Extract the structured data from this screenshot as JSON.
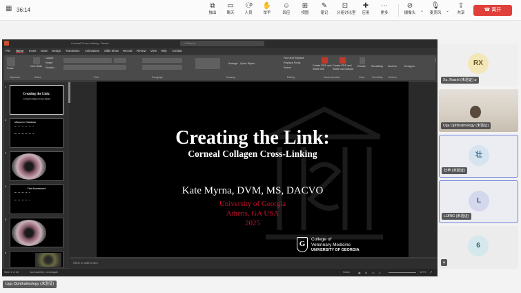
{
  "meeting": {
    "timer": "36:14",
    "toolbar": [
      {
        "label": "独出",
        "icon": "pop-out-icon"
      },
      {
        "label": "聊天",
        "icon": "chat-icon"
      },
      {
        "label": "人员",
        "icon": "people-icon",
        "count": "5"
      },
      {
        "label": "举手",
        "icon": "raise-hand-icon"
      },
      {
        "label": "回应",
        "icon": "react-icon"
      },
      {
        "label": "视图",
        "icon": "view-icon"
      },
      {
        "label": "笔记",
        "icon": "notes-icon"
      },
      {
        "label": "分组讨论室",
        "icon": "breakout-icon"
      },
      {
        "label": "应用",
        "icon": "apps-icon"
      },
      {
        "label": "更多",
        "icon": "more-icon"
      }
    ],
    "camera_label": "摄像头",
    "mic_label": "麦克风",
    "share_label": "共享",
    "leave_label": "离开"
  },
  "powerpoint": {
    "title": "Corneal Cross-Linking - Saved",
    "search_placeholder": "Search",
    "tabs": [
      "File",
      "Home",
      "Insert",
      "Draw",
      "Design",
      "Transitions",
      "Animations",
      "Slide Show",
      "Record",
      "Review",
      "View",
      "Help",
      "Acrobat"
    ],
    "active_tab": "Home",
    "share_label": "Share",
    "ribbon_groups": [
      "Clipboard",
      "Slides",
      "Font",
      "Paragraph",
      "Drawing",
      "Editing",
      "Adobe Acrobat",
      "Voice",
      "Sensitivity",
      "Add-ins"
    ],
    "ribbon_buttons": {
      "paste": "Paste",
      "new_slide": "New Slide",
      "layout": "Layout",
      "reset": "Reset",
      "section": "Section",
      "arrange": "Arrange",
      "quick_styles": "Quick Styles",
      "find_replace": "Find and Replace",
      "replace_fonts": "Replace Fonts",
      "select": "Select",
      "create_pdf": "Create PDF and Share link",
      "create_pdf_outlook": "Create PDF and Share via Outlook",
      "dictate": "Dictate",
      "sensitivity": "Sensitivity",
      "addins": "Add-ins",
      "designer": "Designer"
    },
    "thumbnails": [
      {
        "num": "1",
        "title": "Creating the Link:",
        "sub": "Corneal Collagen Cross-Linking"
      },
      {
        "num": "2",
        "title": "Misnomer Database",
        "sub": ""
      },
      {
        "num": "3",
        "title": "",
        "sub": ""
      },
      {
        "num": "4",
        "title": "First Assessment",
        "sub": ""
      },
      {
        "num": "5",
        "title": "",
        "sub": ""
      },
      {
        "num": "6",
        "title": "",
        "sub": ""
      }
    ],
    "slide": {
      "title": "Creating the Link:",
      "subtitle": "Corneal Collagen Cross-Linking",
      "author": "Kate Myrna, DVM, MS, DACVO",
      "affiliation1": "University of Georgia",
      "affiliation2": "Athens, GA USA",
      "year": "2025",
      "college_line1": "College of",
      "college_line2": "Veterinary Medicine",
      "college_line3": "UNIVERSITY OF GEORGIA",
      "logo_letter": "G"
    },
    "notes_placeholder": "Click to add notes",
    "status": {
      "slide_count": "Slide 1 of 46",
      "language": "English (US)",
      "accessibility": "Accessibility: Investigate",
      "notes": "Notes",
      "zoom": "167%"
    }
  },
  "participants": [
    {
      "initials": "RX",
      "name": "Xu, Ruizhi (未验证)",
      "bg": "#f3e7b8",
      "highlight": false,
      "muted": true
    },
    {
      "initials": "",
      "name": "Uga Ophthalmology (未验证)",
      "bg": "#d9d2c6",
      "highlight": false,
      "video": true
    },
    {
      "initials": "壮",
      "name": "壮苹 (未验证)",
      "bg": "#d6e4f0",
      "highlight": true
    },
    {
      "initials": "L",
      "name": "LIJING (未验证)",
      "bg": "#d4d8ec",
      "highlight": true
    },
    {
      "initials": "6",
      "name": "",
      "bg": "#d5e8ee",
      "highlight": false
    }
  ],
  "bottom_label": "Uga Ophthalmology (未验证)"
}
